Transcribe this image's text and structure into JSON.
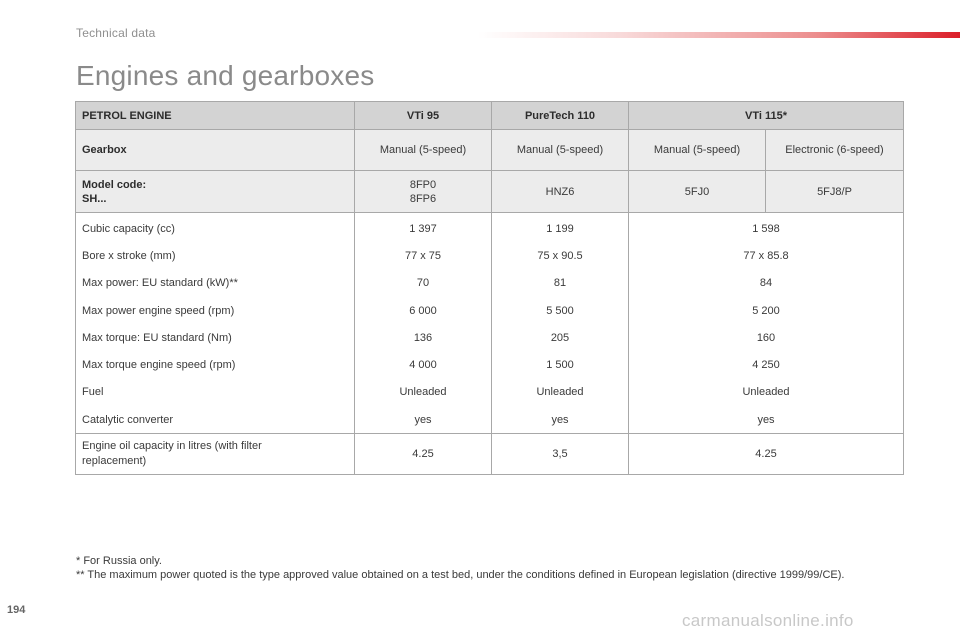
{
  "section_label": "Technical data",
  "page_title": "Engines and gearboxes",
  "table": {
    "header": [
      "PETROL ENGINE",
      "VTi 95",
      "PureTech 110",
      "VTi 115*"
    ],
    "gearbox": {
      "label": "Gearbox",
      "values": [
        "Manual (5-speed)",
        "Manual (5-speed)",
        "Manual (5-speed)",
        "Electronic (6-speed)"
      ]
    },
    "model_code": {
      "label_line1": "Model code:",
      "label_line2": "SH...",
      "vti95_line1": "8FP0",
      "vti95_line2": "8FP6",
      "puretech110": "HNZ6",
      "vti115_manual": "5FJ0",
      "vti115_electronic": "5FJ8/P"
    },
    "rows": [
      {
        "label": "Cubic capacity (cc)",
        "vti95": "1 397",
        "puretech110": "1 199",
        "vti115": "1 598"
      },
      {
        "label": "Bore x stroke (mm)",
        "vti95": "77 x 75",
        "puretech110": "75 x 90.5",
        "vti115": "77 x 85.8"
      },
      {
        "label": "Max power: EU standard (kW)**",
        "vti95": "70",
        "puretech110": "81",
        "vti115": "84"
      },
      {
        "label": "Max power engine speed (rpm)",
        "vti95": "6 000",
        "puretech110": "5 500",
        "vti115": "5 200"
      },
      {
        "label": "Max torque: EU standard (Nm)",
        "vti95": "136",
        "puretech110": "205",
        "vti115": "160"
      },
      {
        "label": "Max torque engine speed (rpm)",
        "vti95": "4 000",
        "puretech110": "1 500",
        "vti115": "4 250"
      },
      {
        "label": "Fuel",
        "vti95": "Unleaded",
        "puretech110": "Unleaded",
        "vti115": "Unleaded"
      },
      {
        "label": "Catalytic converter",
        "vti95": "yes",
        "puretech110": "yes",
        "vti115": "yes"
      }
    ],
    "oil": {
      "label_line1": "Engine oil capacity in litres (with filter",
      "label_line2": "replacement)",
      "vti95": "4.25",
      "puretech110": "3,5",
      "vti115": "4.25"
    }
  },
  "footnotes": {
    "note1": "* For Russia only.",
    "note2": "** The maximum power quoted is the type approved value obtained on a test bed, under the conditions defined in European legislation (directive 1999/99/CE)."
  },
  "page_number": "194",
  "watermark": "carmanualsonline.info",
  "colors": {
    "accent_red": "#db1e29",
    "header_fill": "#d3d3d3",
    "subheader_fill": "#ececec",
    "border": "#a8a8a8"
  }
}
